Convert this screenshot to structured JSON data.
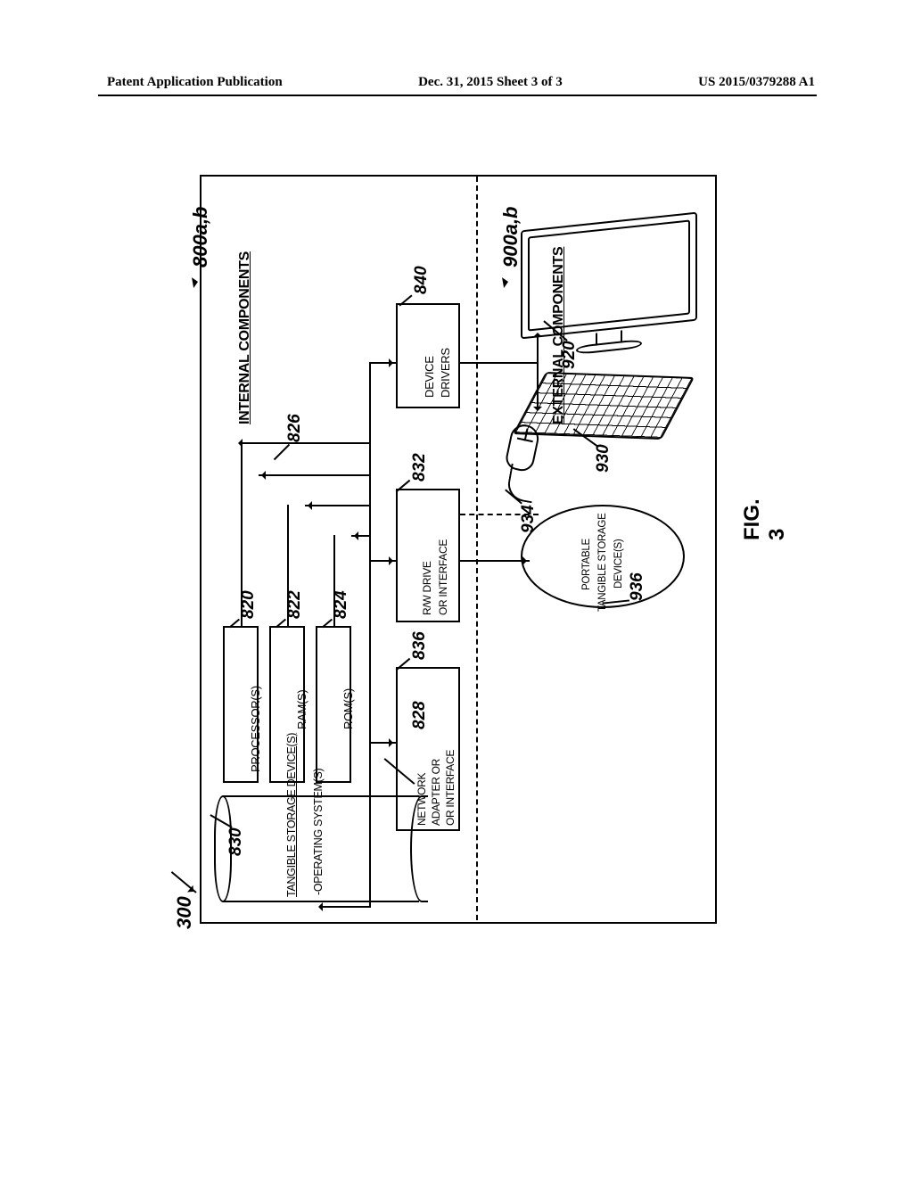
{
  "header": {
    "left": "Patent Application Publication",
    "center": "Dec. 31, 2015  Sheet 3 of 3",
    "right": "US 2015/0379288 A1"
  },
  "figure": {
    "caption": "FIG. 3",
    "overall_ref": "300",
    "internal_ref": "800a,b",
    "external_ref": "900a,b",
    "internal_heading": "INTERNAL COMPONENTS",
    "external_heading": "EXTERNAL COMPONENTS",
    "processor": {
      "label": "PROCESSOR(S)",
      "ref": "820"
    },
    "ram": {
      "label": "RAM(S)",
      "ref": "822"
    },
    "rom": {
      "label": "ROM(S)",
      "ref": "824"
    },
    "bus_ref": "826",
    "storage": {
      "label": "TANGIBLE STORAGE DEVICE(S)",
      "os": "OPERATING SYSTEM(S)",
      "ref": "830",
      "os_ref": "828"
    },
    "device_drivers": {
      "l1": "DEVICE",
      "l2": "DRIVERS",
      "ref": "840"
    },
    "rw_drive": {
      "l1": "R/W DRIVE",
      "l2": "OR INTERFACE",
      "ref": "832"
    },
    "net_adapter": {
      "l1": "NETWORK",
      "l2": "ADAPTER OR",
      "l3": "OR INTERFACE",
      "ref": "836"
    },
    "monitor_ref": "920",
    "keyboard_ref": "930",
    "mouse_ref": "934",
    "portable": {
      "l1": "PORTABLE",
      "l2": "TANGIBLE STORAGE",
      "l3": "DEVICE(S)",
      "ref": "936"
    }
  }
}
